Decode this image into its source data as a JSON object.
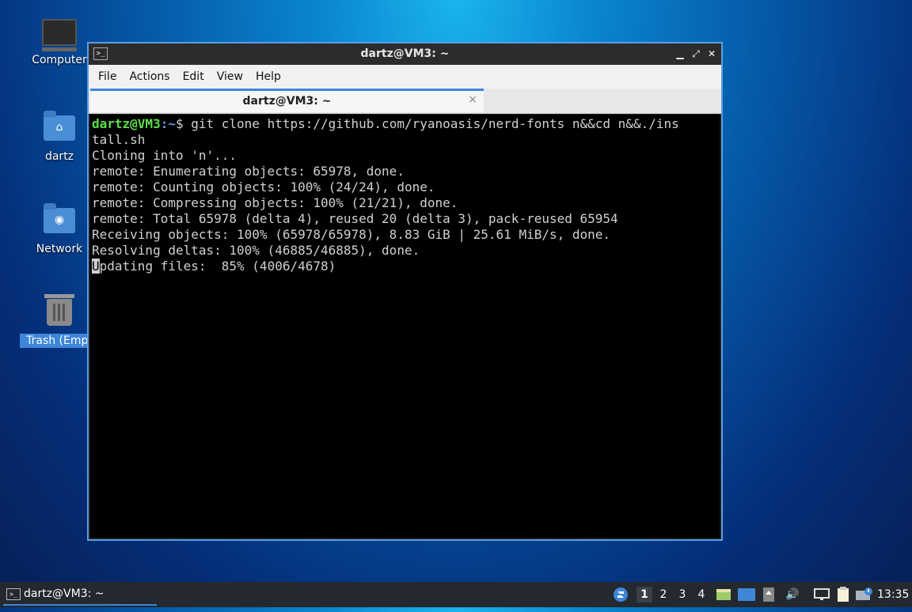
{
  "desktop": {
    "icons": [
      {
        "label": "Computer"
      },
      {
        "label": "dartz"
      },
      {
        "label": "Network"
      },
      {
        "label": "Trash (Empt"
      }
    ]
  },
  "window": {
    "title": "dartz@VM3: ~",
    "menu": [
      "File",
      "Actions",
      "Edit",
      "View",
      "Help"
    ],
    "tab": {
      "label": "dartz@VM3: ~",
      "close": "×"
    },
    "terminal": {
      "prompt_user": "dartz@VM3",
      "prompt_path": ":~",
      "prompt_sign": "$ ",
      "command_line1": "git clone https://github.com/ryanoasis/nerd-fonts n&&cd n&&./ins",
      "command_line2": "tall.sh",
      "output": [
        "Cloning into 'n'...",
        "remote: Enumerating objects: 65978, done.",
        "remote: Counting objects: 100% (24/24), done.",
        "remote: Compressing objects: 100% (21/21), done.",
        "remote: Total 65978 (delta 4), reused 20 (delta 3), pack-reused 65954",
        "Receiving objects: 100% (65978/65978), 8.83 GiB | 25.61 MiB/s, done.",
        "Resolving deltas: 100% (46885/46885), done."
      ],
      "current_first_char": "U",
      "current_rest": "pdating files:  85% (4006/4678)"
    }
  },
  "taskbar": {
    "task_label": "dartz@VM3: ~",
    "workspaces": [
      "1",
      "2",
      "3",
      "4"
    ],
    "active_workspace": "1",
    "clock": "13:35"
  },
  "colors": {
    "accent": "#3d86d8",
    "prompt_user": "#5ee04a",
    "prompt_path": "#5b9fe3",
    "terminal_bg": "#000000",
    "terminal_fg": "#d0d0d0"
  },
  "icons": [
    "terminal-icon",
    "minimize-icon",
    "maximize-icon",
    "close-icon",
    "home-folder-icon",
    "network-folder-icon",
    "trash-icon",
    "computer-icon",
    "start-menu-icon",
    "volume-icon",
    "network-status-icon",
    "clipboard-icon",
    "notification-icon"
  ]
}
